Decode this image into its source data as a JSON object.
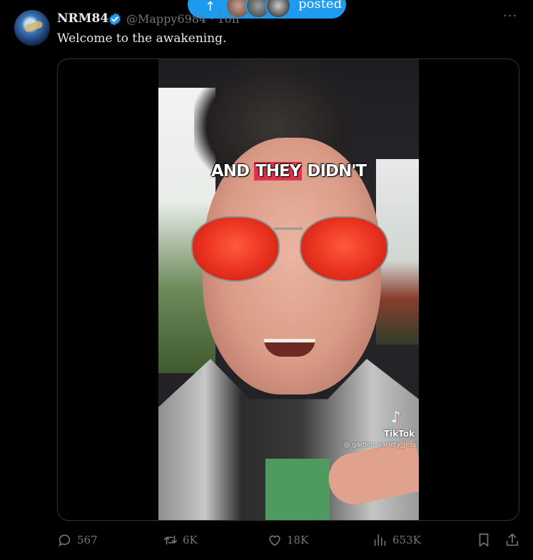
{
  "pill": {
    "arrow": "↑",
    "label": "posted"
  },
  "author": {
    "display_name": "NRM84",
    "handle": "@Mappy6984",
    "separator": "·",
    "age": "10h"
  },
  "tweet": {
    "text": "Welcome to the awakening."
  },
  "video": {
    "caption_pre": "AND ",
    "caption_highlight": "THEY",
    "caption_post": " DIDN'T",
    "watermark_logo": "♪",
    "watermark_name": "TikTok",
    "watermark_user": "@ garden_variety_jess"
  },
  "actions": {
    "replies": "567",
    "reposts": "6K",
    "likes": "18K",
    "views": "653K"
  },
  "colors": {
    "accent": "#1d9bf0",
    "muted": "#71767b",
    "text": "#e7e9ea",
    "border": "#2f3336"
  }
}
